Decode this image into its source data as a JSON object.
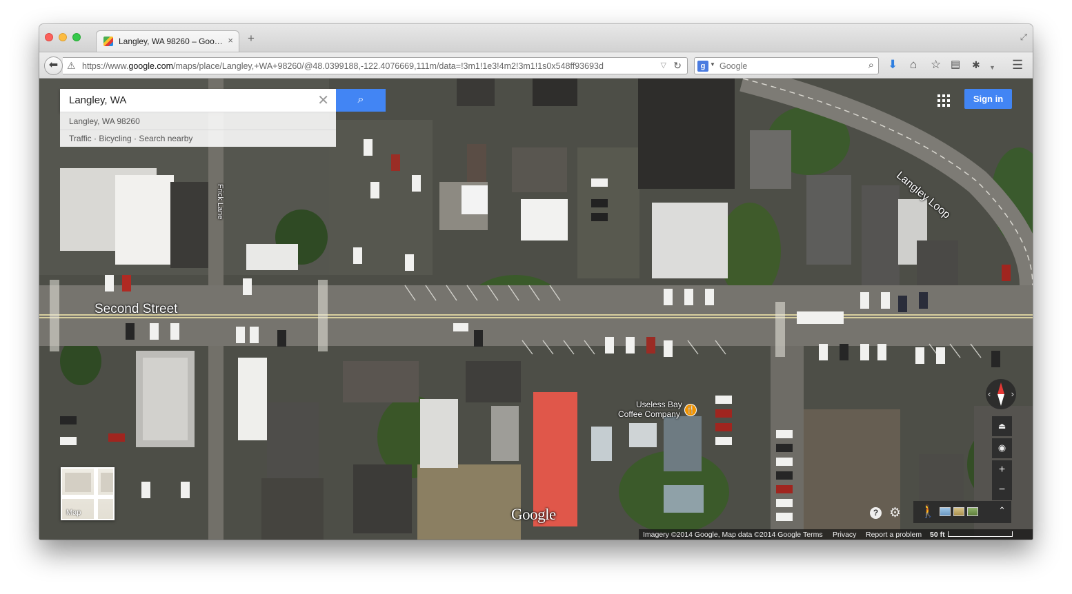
{
  "browser": {
    "tab_title": "Langley, WA 98260 – Goo…",
    "tab_close": "×",
    "new_tab": "+",
    "url_prefix": "https://www.",
    "url_domain": "google.com",
    "url_rest": "/maps/place/Langley,+WA+98260/@48.0399188,-122.4076669,111m/data=!3m1!1e3!4m2!3m1!1s0x548ff93693d",
    "search_engine": "Google",
    "icons": [
      "back-icon",
      "warning-icon",
      "reload-icon",
      "search-icon",
      "download-icon",
      "home-icon",
      "bookmark-star-icon",
      "reading-list-icon",
      "extension-icon",
      "menu-icon",
      "fullscreen-icon"
    ]
  },
  "maps": {
    "search_value": "Langley, WA",
    "suggestion_place": "Langley, WA 98260",
    "suggestion_links": "Traffic · Bicycling · Search nearby",
    "sign_in": "Sign in",
    "map_thumb_label": "Map",
    "logo": "Google",
    "labels": {
      "second_street": "Second Street",
      "langley_loop": "Langley Loop",
      "frick_lane": "Frick Lane",
      "cafe_line1": "Useless Bay",
      "cafe_line2": "Coffee Company"
    },
    "footer": {
      "imagery": "Imagery ©2014 Google, Map data ©2014 Google",
      "terms": "Terms",
      "privacy": "Privacy",
      "report": "Report a problem",
      "scale": "50 ft"
    },
    "controls": {
      "zoom_in": "+",
      "zoom_out": "−",
      "help": "?"
    }
  }
}
